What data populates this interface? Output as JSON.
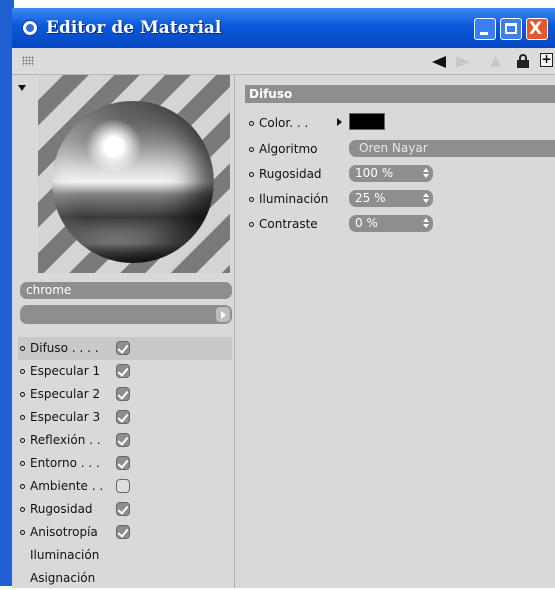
{
  "window": {
    "title": "Editor de Material",
    "close_symbol": "X"
  },
  "material": {
    "name": "chrome"
  },
  "channels": [
    {
      "label": "Difuso . . . .",
      "enabled": true,
      "selected": true
    },
    {
      "label": "Especular 1",
      "enabled": true
    },
    {
      "label": "Especular 2",
      "enabled": true
    },
    {
      "label": "Especular 3",
      "enabled": true
    },
    {
      "label": "Reflexión . .",
      "enabled": true
    },
    {
      "label": "Entorno . . .",
      "enabled": true
    },
    {
      "label": "Ambiente . .",
      "enabled": false
    },
    {
      "label": "Rugosidad",
      "enabled": true
    },
    {
      "label": "Anisotropía",
      "enabled": true
    }
  ],
  "extra_items": [
    "Iluminación",
    "Asignación"
  ],
  "diffuse": {
    "header": "Difuso",
    "color_label": "Color. . .",
    "color_value": "#000000",
    "algorithm_label": "Algoritmo",
    "algorithm_value": "Oren Nayar",
    "roughness_label": "Rugosidad",
    "roughness_value": "100 %",
    "illumination_label": "Iluminación",
    "illumination_value": "25 %",
    "contrast_label": "Contraste",
    "contrast_value": "0 %"
  },
  "icons": [
    "app-icon",
    "minimize-icon",
    "maximize-icon",
    "close-icon",
    "grip-icon",
    "back-arrow-icon",
    "forward-arrow-icon",
    "up-icon",
    "lock-icon",
    "new-window-icon",
    "collapse-triangle-icon",
    "chevron-right-icon"
  ],
  "colors": {
    "titlebar": "#0a58d8",
    "panel": "#d9d9d9",
    "field": "#8e8e8e",
    "close": "#e25a2c"
  }
}
